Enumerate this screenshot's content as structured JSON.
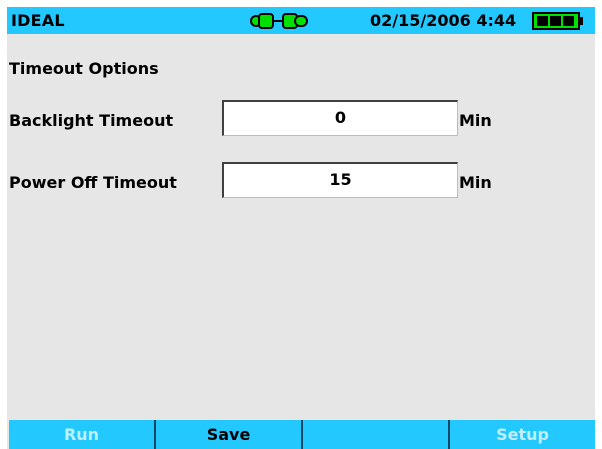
{
  "header": {
    "brand": "IDEAL",
    "datetime": "02/15/2006 4:44",
    "colors": {
      "bar": "#22c8ff",
      "accent": "#00e000"
    }
  },
  "content": {
    "section_title": "Timeout Options",
    "rows": [
      {
        "label": "Backlight Timeout",
        "value": "0",
        "unit": "Min"
      },
      {
        "label": "Power Off Timeout",
        "value": "15",
        "unit": "Min"
      }
    ]
  },
  "softkeys": [
    {
      "label": "Run",
      "enabled": false
    },
    {
      "label": "Save",
      "enabled": true
    },
    {
      "label": "",
      "enabled": false
    },
    {
      "label": "Setup",
      "enabled": false
    }
  ],
  "icons": {
    "connector": "link-icon",
    "battery": "battery-icon"
  }
}
